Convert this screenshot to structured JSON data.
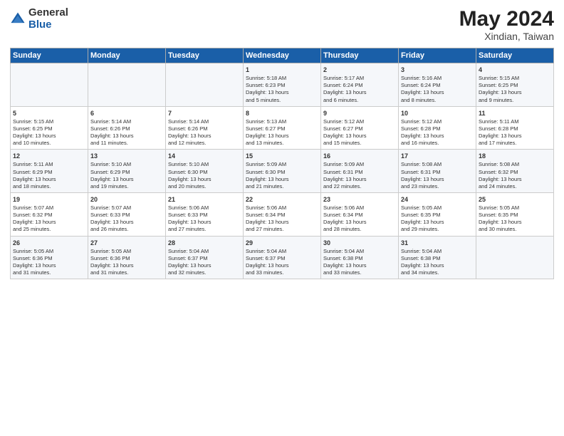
{
  "header": {
    "logo_general": "General",
    "logo_blue": "Blue",
    "title": "May 2024",
    "subtitle": "Xindian, Taiwan"
  },
  "days_of_week": [
    "Sunday",
    "Monday",
    "Tuesday",
    "Wednesday",
    "Thursday",
    "Friday",
    "Saturday"
  ],
  "weeks": [
    [
      {
        "day": "",
        "info": ""
      },
      {
        "day": "",
        "info": ""
      },
      {
        "day": "",
        "info": ""
      },
      {
        "day": "1",
        "info": "Sunrise: 5:18 AM\nSunset: 6:23 PM\nDaylight: 13 hours\nand 5 minutes."
      },
      {
        "day": "2",
        "info": "Sunrise: 5:17 AM\nSunset: 6:24 PM\nDaylight: 13 hours\nand 6 minutes."
      },
      {
        "day": "3",
        "info": "Sunrise: 5:16 AM\nSunset: 6:24 PM\nDaylight: 13 hours\nand 8 minutes."
      },
      {
        "day": "4",
        "info": "Sunrise: 5:15 AM\nSunset: 6:25 PM\nDaylight: 13 hours\nand 9 minutes."
      }
    ],
    [
      {
        "day": "5",
        "info": "Sunrise: 5:15 AM\nSunset: 6:25 PM\nDaylight: 13 hours\nand 10 minutes."
      },
      {
        "day": "6",
        "info": "Sunrise: 5:14 AM\nSunset: 6:26 PM\nDaylight: 13 hours\nand 11 minutes."
      },
      {
        "day": "7",
        "info": "Sunrise: 5:14 AM\nSunset: 6:26 PM\nDaylight: 13 hours\nand 12 minutes."
      },
      {
        "day": "8",
        "info": "Sunrise: 5:13 AM\nSunset: 6:27 PM\nDaylight: 13 hours\nand 13 minutes."
      },
      {
        "day": "9",
        "info": "Sunrise: 5:12 AM\nSunset: 6:27 PM\nDaylight: 13 hours\nand 15 minutes."
      },
      {
        "day": "10",
        "info": "Sunrise: 5:12 AM\nSunset: 6:28 PM\nDaylight: 13 hours\nand 16 minutes."
      },
      {
        "day": "11",
        "info": "Sunrise: 5:11 AM\nSunset: 6:28 PM\nDaylight: 13 hours\nand 17 minutes."
      }
    ],
    [
      {
        "day": "12",
        "info": "Sunrise: 5:11 AM\nSunset: 6:29 PM\nDaylight: 13 hours\nand 18 minutes."
      },
      {
        "day": "13",
        "info": "Sunrise: 5:10 AM\nSunset: 6:29 PM\nDaylight: 13 hours\nand 19 minutes."
      },
      {
        "day": "14",
        "info": "Sunrise: 5:10 AM\nSunset: 6:30 PM\nDaylight: 13 hours\nand 20 minutes."
      },
      {
        "day": "15",
        "info": "Sunrise: 5:09 AM\nSunset: 6:30 PM\nDaylight: 13 hours\nand 21 minutes."
      },
      {
        "day": "16",
        "info": "Sunrise: 5:09 AM\nSunset: 6:31 PM\nDaylight: 13 hours\nand 22 minutes."
      },
      {
        "day": "17",
        "info": "Sunrise: 5:08 AM\nSunset: 6:31 PM\nDaylight: 13 hours\nand 23 minutes."
      },
      {
        "day": "18",
        "info": "Sunrise: 5:08 AM\nSunset: 6:32 PM\nDaylight: 13 hours\nand 24 minutes."
      }
    ],
    [
      {
        "day": "19",
        "info": "Sunrise: 5:07 AM\nSunset: 6:32 PM\nDaylight: 13 hours\nand 25 minutes."
      },
      {
        "day": "20",
        "info": "Sunrise: 5:07 AM\nSunset: 6:33 PM\nDaylight: 13 hours\nand 26 minutes."
      },
      {
        "day": "21",
        "info": "Sunrise: 5:06 AM\nSunset: 6:33 PM\nDaylight: 13 hours\nand 27 minutes."
      },
      {
        "day": "22",
        "info": "Sunrise: 5:06 AM\nSunset: 6:34 PM\nDaylight: 13 hours\nand 27 minutes."
      },
      {
        "day": "23",
        "info": "Sunrise: 5:06 AM\nSunset: 6:34 PM\nDaylight: 13 hours\nand 28 minutes."
      },
      {
        "day": "24",
        "info": "Sunrise: 5:05 AM\nSunset: 6:35 PM\nDaylight: 13 hours\nand 29 minutes."
      },
      {
        "day": "25",
        "info": "Sunrise: 5:05 AM\nSunset: 6:35 PM\nDaylight: 13 hours\nand 30 minutes."
      }
    ],
    [
      {
        "day": "26",
        "info": "Sunrise: 5:05 AM\nSunset: 6:36 PM\nDaylight: 13 hours\nand 31 minutes."
      },
      {
        "day": "27",
        "info": "Sunrise: 5:05 AM\nSunset: 6:36 PM\nDaylight: 13 hours\nand 31 minutes."
      },
      {
        "day": "28",
        "info": "Sunrise: 5:04 AM\nSunset: 6:37 PM\nDaylight: 13 hours\nand 32 minutes."
      },
      {
        "day": "29",
        "info": "Sunrise: 5:04 AM\nSunset: 6:37 PM\nDaylight: 13 hours\nand 33 minutes."
      },
      {
        "day": "30",
        "info": "Sunrise: 5:04 AM\nSunset: 6:38 PM\nDaylight: 13 hours\nand 33 minutes."
      },
      {
        "day": "31",
        "info": "Sunrise: 5:04 AM\nSunset: 6:38 PM\nDaylight: 13 hours\nand 34 minutes."
      },
      {
        "day": "",
        "info": ""
      }
    ]
  ]
}
